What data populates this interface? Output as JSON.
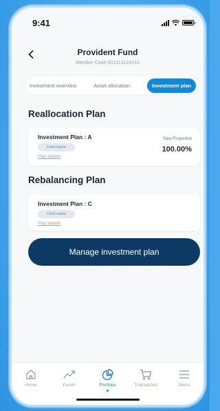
{
  "status": {
    "time": "9:41"
  },
  "header": {
    "title": "Provident Fund",
    "member_code": "Member Code 901213124412"
  },
  "tabs": [
    {
      "label": "Investment overview",
      "active": false
    },
    {
      "label": "Asset allocation",
      "active": false
    },
    {
      "label": "Investment plan",
      "active": true
    }
  ],
  "reallocation": {
    "title": "Reallocation Plan",
    "card": {
      "plan": "Investment Plan : A",
      "fund": "Fund name",
      "details": "Plan details",
      "proportion_label": "New Proportion",
      "proportion_value": "100.00%"
    }
  },
  "rebalancing": {
    "title": "Rebalancing Plan",
    "card": {
      "plan": "Investment Plan : C",
      "fund": "Fund name",
      "details": "Plan details"
    }
  },
  "manage_button": "Manage investment plan",
  "nav": [
    {
      "label": "Home",
      "icon": "home-icon"
    },
    {
      "label": "Funds",
      "icon": "trend-icon"
    },
    {
      "label": "Portfolio",
      "icon": "pie-chart-icon",
      "active": true
    },
    {
      "label": "Transaction",
      "icon": "cart-icon"
    },
    {
      "label": "Menu",
      "icon": "menu-icon"
    }
  ],
  "colors": {
    "accent": "#1487d6",
    "button": "#0c3a64",
    "background": "#4aa8ee"
  }
}
